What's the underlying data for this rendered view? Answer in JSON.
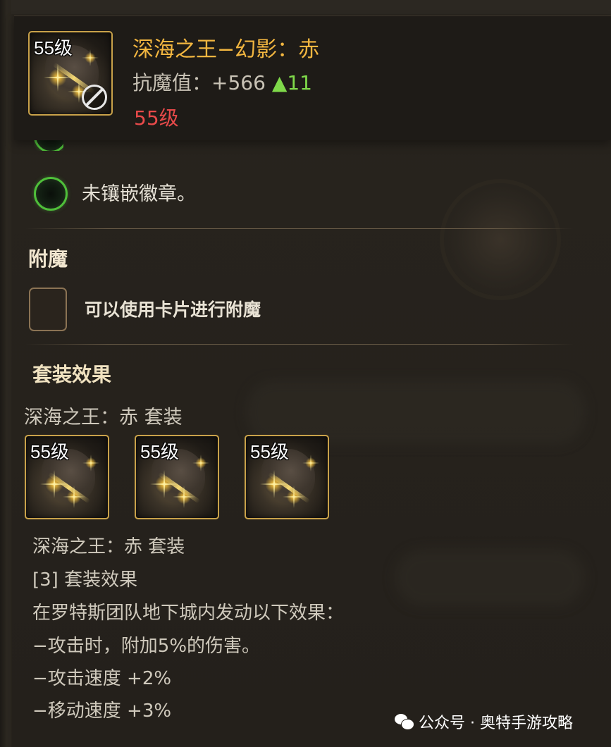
{
  "header": {
    "item_level_badge": "55级",
    "item_name": "深海之王−幻影：赤",
    "stat_label": "抗魔值：",
    "stat_value": "+566",
    "stat_increase": "▲11",
    "required_level": "55级"
  },
  "sockets": {
    "empty_badge_text": "未镶嵌徽章。"
  },
  "enchant": {
    "title": "附魔",
    "hint": "可以使用卡片进行附魔"
  },
  "set_effect": {
    "title": "套装效果",
    "set_name_top": "深海之王：赤  套装",
    "pieces": [
      {
        "level": "55级"
      },
      {
        "level": "55级"
      },
      {
        "level": "55级"
      }
    ],
    "set_name_bottom": "深海之王：赤  套装",
    "bonus_header": "[3] 套装效果",
    "condition": "在罗特斯团队地下城内发动以下效果：",
    "effects": [
      "−攻击时，附加5%的伤害。",
      "−攻击速度 +2%",
      "−移动速度 +3%"
    ]
  },
  "watermark": {
    "text": "公众号 · 奥特手游攻略"
  },
  "colors": {
    "item_name": "#f2b640",
    "stat_up": "#7fd94a",
    "level_red": "#e84a4a",
    "socket_ring": "#4fbf3a",
    "icon_border": "#c9a24a"
  }
}
